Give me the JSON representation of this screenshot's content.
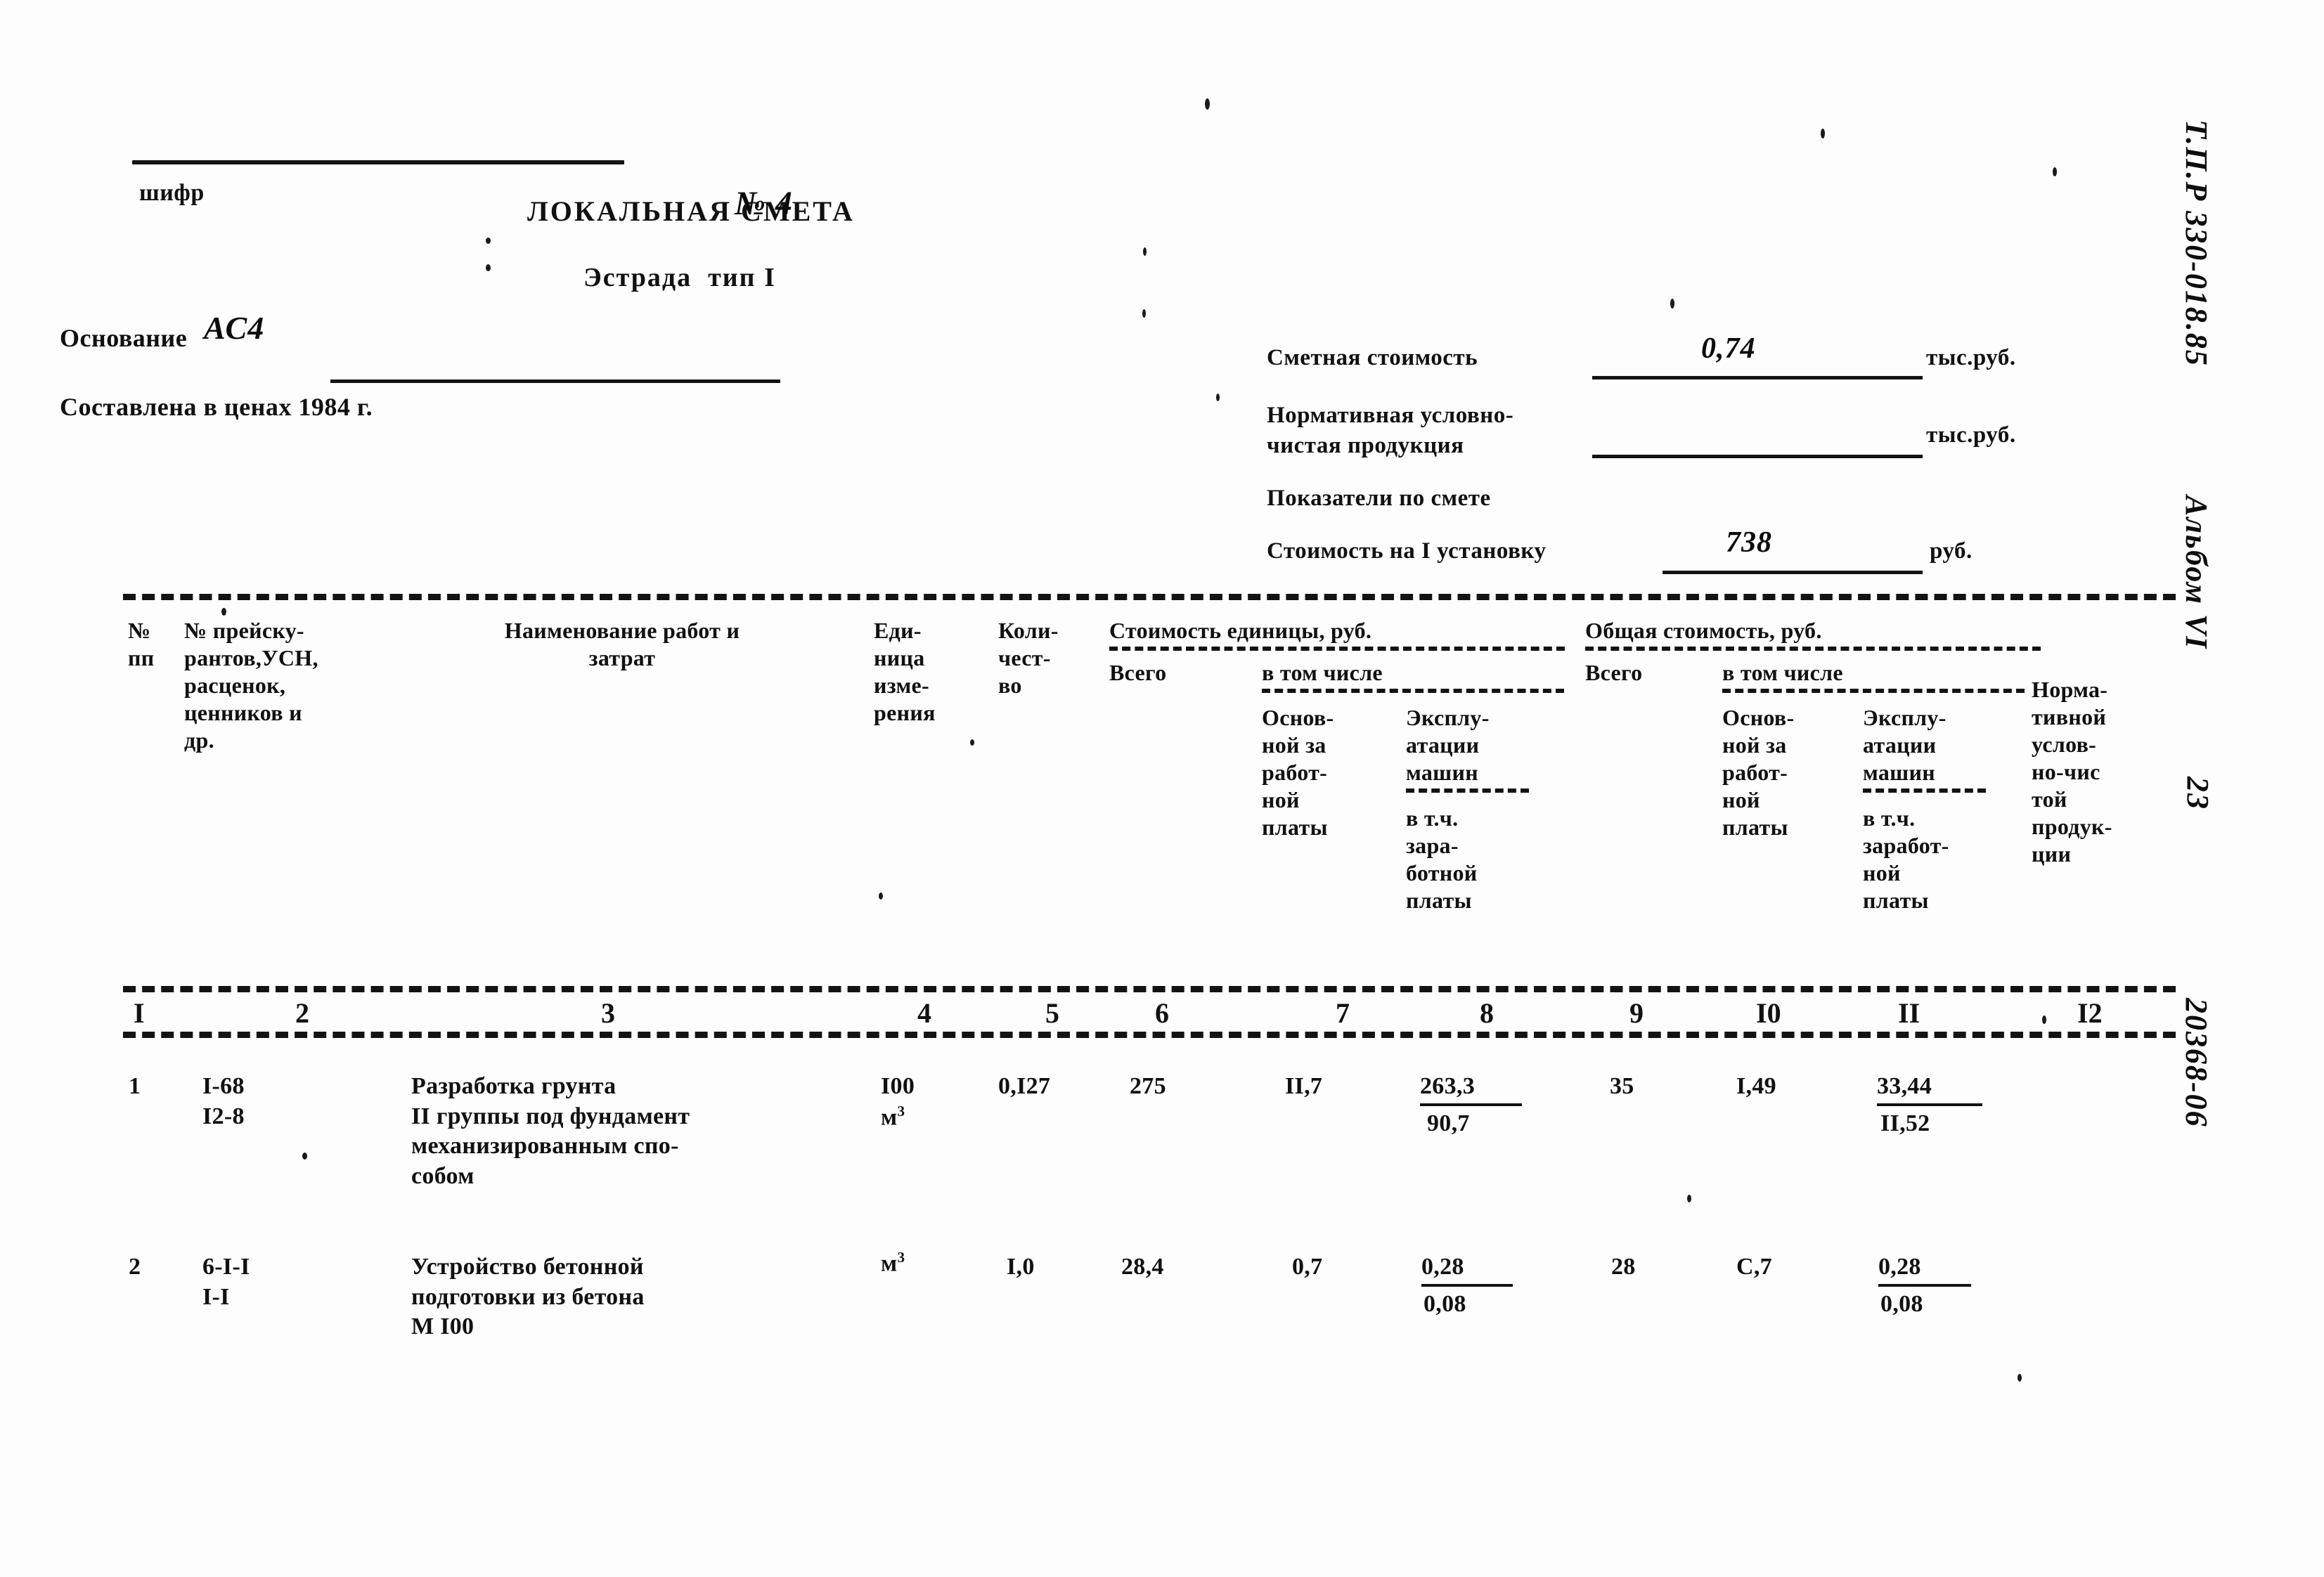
{
  "document": {
    "title": "ЛОКАЛЬНАЯ СМЕТА",
    "number": "№ 4",
    "subtitle": "Эстрада  тип I",
    "shifr_label": "шифр",
    "osnovanie_label": "Основание",
    "osnovanie_value": "АС4",
    "prices_note": "Составлена в ценах 1984 г."
  },
  "summary": {
    "estimate_cost_label": "Сметная стоимость",
    "estimate_cost_value": "0,74",
    "estimate_cost_unit": "тыс.руб.",
    "net_product_label_line1": "Нормативная условно-",
    "net_product_label_line2": "чистая продукция",
    "net_product_value": "",
    "net_product_unit": "тыс.руб.",
    "indicators_label": "Показатели по смете",
    "per_unit_label": "Стоимость на I установку",
    "per_unit_value": "738",
    "per_unit_unit": "руб."
  },
  "table": {
    "headers": {
      "col1": "№\nпп",
      "col2": "№ прейску-\nрантов,УСН,\nрасценок,\nценников и\nдр.",
      "col3": "Наименование работ и\nзатрат",
      "col4": "Еди-\nница\nизме-\nрения",
      "col5": "Коли-\nчест-\nво",
      "group_unit_cost": "Стоимость единицы, руб.",
      "col6": "Всего",
      "group_unit_among": "в том числе",
      "col7": "Основ-\nной за\nработ-\nной\nплаты",
      "col8_a": "Эксплу-\nатации\nмашин",
      "col8_b": "в т.ч.\nзара-\nботной\nплаты",
      "group_total_cost": "Общая стоимость, руб.",
      "col9": "Всего",
      "group_total_among": "в том числе",
      "col10": "Основ-\nной за\nработ-\nной\nплаты",
      "col11_a": "Эксплу-\nатации\nмашин",
      "col11_b": "в т.ч.\nзаработ-\nной\nплаты",
      "col12": "Норма-\nтивной\nуслов-\nно-чис\nтой\nпродук-\nции"
    },
    "column_numbers": [
      "I",
      "2",
      "3",
      "4",
      "5",
      "6",
      "7",
      "8",
      "9",
      "I0",
      "II",
      "I2"
    ],
    "rows": [
      {
        "num": "1",
        "code": "I-68\nI2-8",
        "name": "Разработка грунта\nII группы под фундамент\nмеханизированным спо-\nсобом",
        "unit_main": "I00",
        "unit_sub": "м",
        "unit_sup": "3",
        "qty": "0,I27",
        "unit_total": "275",
        "unit_wage": "II,7",
        "unit_mach_top": "263,3",
        "unit_mach_bot": "90,7",
        "total_all": "35",
        "total_wage": "I,49",
        "total_mach_top": "33,44",
        "total_mach_bot": "II,52",
        "net_product": ""
      },
      {
        "num": "2",
        "code": "6-I-I\nI-I",
        "name": "Устройство бетонной\nподготовки из бетона\nМ I00",
        "unit_main": "м",
        "unit_sub": "",
        "unit_sup": "3",
        "qty": "I,0",
        "unit_total": "28,4",
        "unit_wage": "0,7",
        "unit_mach_top": "0,28",
        "unit_mach_bot": "0,08",
        "total_all": "28",
        "total_wage": "С,7",
        "total_mach_top": "0,28",
        "total_mach_bot": "0,08",
        "net_product": ""
      }
    ]
  },
  "margin": {
    "code_top": "Т.П.Р 330-018.85",
    "album": "Альбом VI",
    "page": "23",
    "code_bottom": "20368-06"
  }
}
